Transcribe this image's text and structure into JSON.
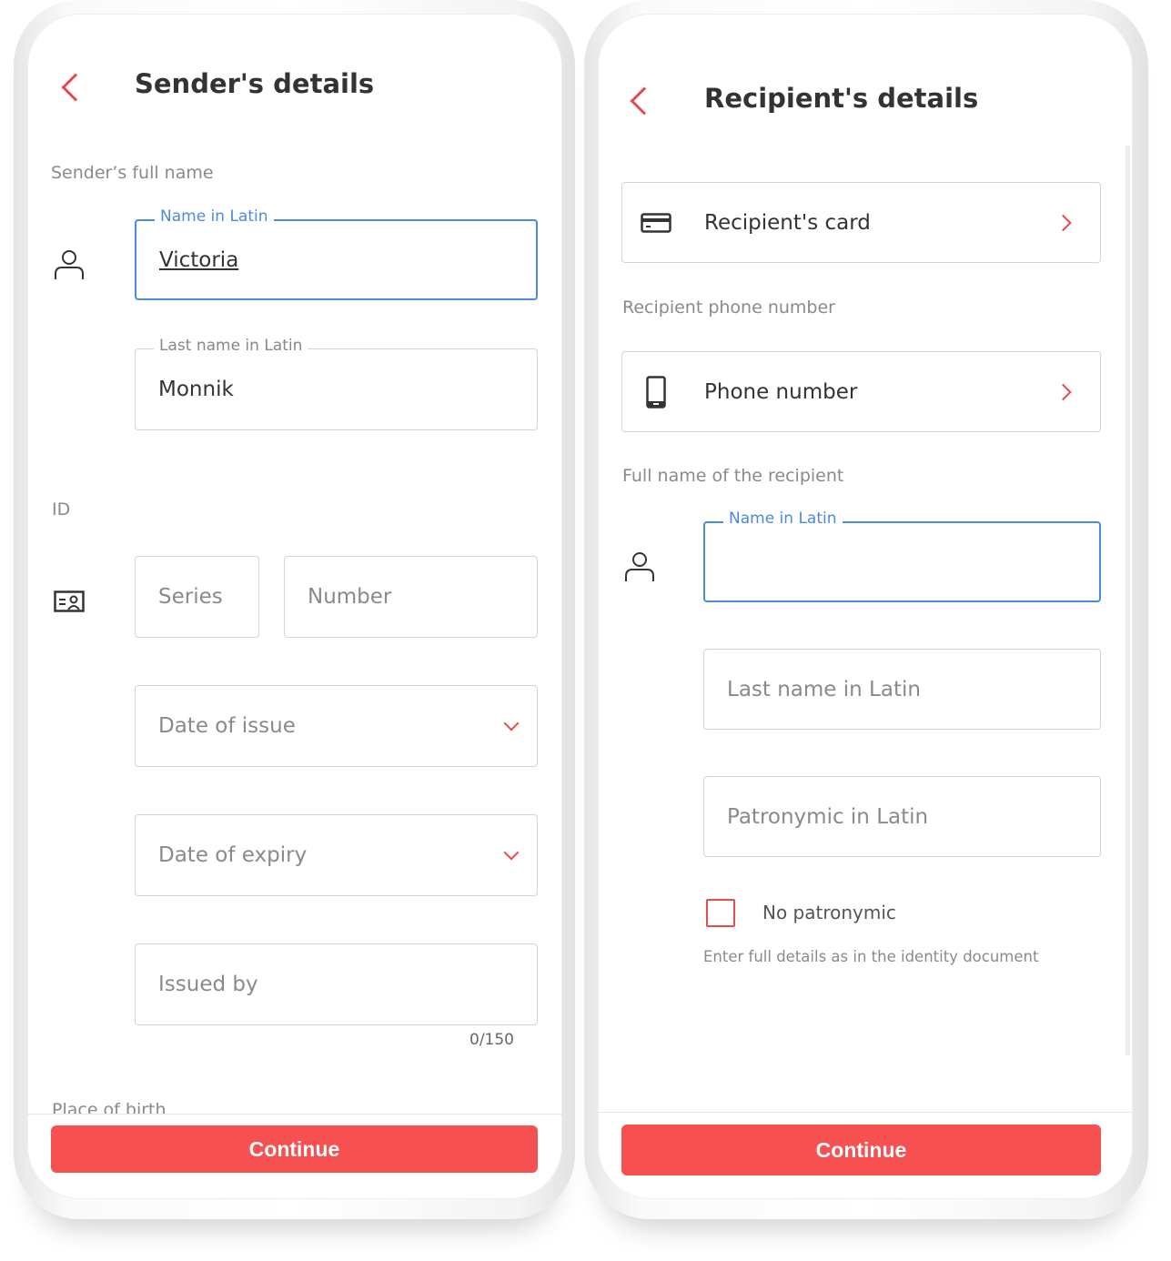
{
  "sender": {
    "title": "Sender's details",
    "full_name_label": "Sender’s full name",
    "name_field": {
      "label": "Name in Latin",
      "value": "Victoria"
    },
    "last_name_field": {
      "label": "Last name in Latin",
      "value": "Monnik"
    },
    "id_label": "ID",
    "series_placeholder": "Series",
    "number_placeholder": "Number",
    "date_issue_placeholder": "Date of issue",
    "date_expiry_placeholder": "Date of expiry",
    "issued_by_placeholder": "Issued by",
    "issued_by_counter": "0/150",
    "place_of_birth_label": "Place of birth",
    "continue_label": "Continue"
  },
  "recipient": {
    "title": "Recipient's details",
    "card_label": "Recipient's card",
    "phone_section_label": "Recipient phone number",
    "phone_label": "Phone number",
    "full_name_label": "Full name of the recipient",
    "name_field": {
      "label": "Name in Latin",
      "value": ""
    },
    "last_name_placeholder": "Last name in Latin",
    "patronymic_placeholder": "Patronymic in Latin",
    "no_patronymic_label": "No patronymic",
    "no_patronymic_checked": false,
    "hint": "Enter full details as in the identity document",
    "continue_label": "Continue"
  },
  "colors": {
    "accent": "#f75050",
    "focus": "#4a8ae0"
  }
}
